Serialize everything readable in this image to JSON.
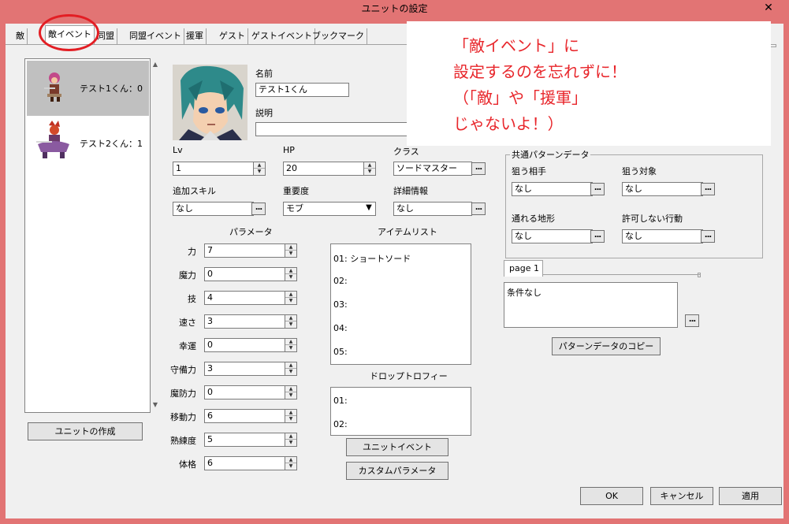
{
  "window": {
    "title": "ユニットの設定",
    "close_glyph": "✕"
  },
  "tabs": [
    {
      "label": "敵"
    },
    {
      "label": "敵イベント"
    },
    {
      "label": "同盟"
    },
    {
      "label": "同盟イベント"
    },
    {
      "label": "援軍"
    },
    {
      "label": "ゲスト"
    },
    {
      "label": "ゲストイベント"
    },
    {
      "label": "ブックマーク"
    }
  ],
  "unit_list": [
    {
      "name": "テスト1くん：0",
      "sprite": "swordsman-sprite-icon"
    },
    {
      "name": "テスト2くん：1",
      "sprite": "demon-rider-sprite-icon"
    }
  ],
  "create_unit_button": "ユニットの作成",
  "portrait": {
    "icon": "character-portrait-icon"
  },
  "fields": {
    "name_label": "名前",
    "name_value": "テスト1くん",
    "desc_label": "説明",
    "desc_value": "",
    "lv_label": "Lv",
    "lv_value": "1",
    "hp_label": "HP",
    "hp_value": "20",
    "class_label": "クラス",
    "class_value": "ソードマスター",
    "skill_label": "追加スキル",
    "skill_value": "なし",
    "importance_label": "重要度",
    "importance_value": "モブ",
    "detail_label": "詳細情報",
    "detail_value": "なし"
  },
  "params": {
    "header": "パラメータ",
    "rows": [
      {
        "label": "力",
        "value": "7"
      },
      {
        "label": "魔力",
        "value": "0"
      },
      {
        "label": "技",
        "value": "4"
      },
      {
        "label": "速さ",
        "value": "3"
      },
      {
        "label": "幸運",
        "value": "0"
      },
      {
        "label": "守備力",
        "value": "3"
      },
      {
        "label": "魔防力",
        "value": "0"
      },
      {
        "label": "移動力",
        "value": "6"
      },
      {
        "label": "熟練度",
        "value": "5"
      },
      {
        "label": "体格",
        "value": "6"
      }
    ]
  },
  "items": {
    "header": "アイテムリスト",
    "rows": [
      "01:  ショートソード",
      "02:",
      "03:",
      "04:",
      "05:"
    ]
  },
  "drop": {
    "header": "ドロップトロフィー",
    "rows": [
      "01:",
      "02:"
    ]
  },
  "unit_event_button": "ユニットイベント",
  "custom_param_button": "カスタムパラメータ",
  "pattern": {
    "group_title": "共通パターンデータ",
    "target_label": "狙う相手",
    "target_value": "なし",
    "object_label": "狙う対象",
    "object_value": "なし",
    "terrain_label": "通れる地形",
    "terrain_value": "なし",
    "forbid_label": "許可しない行動",
    "forbid_value": "なし",
    "page_tab": "page 1",
    "condition_text": "条件なし",
    "copy_button": "パターンデータのコピー"
  },
  "footer": {
    "ok": "OK",
    "cancel": "キャンセル",
    "apply": "適用"
  },
  "annotation": {
    "lines": [
      "「敵イベント」に",
      "設定するのを忘れずに！",
      "（「敵」や「援軍」",
      "じゃないよ！）"
    ],
    "color": "#e8262b"
  },
  "dots_glyph": "...",
  "combo_glyph": "▼",
  "spin_up": "▲",
  "spin_down": "▼",
  "scroll_up": "▲",
  "scroll_down": "▼"
}
